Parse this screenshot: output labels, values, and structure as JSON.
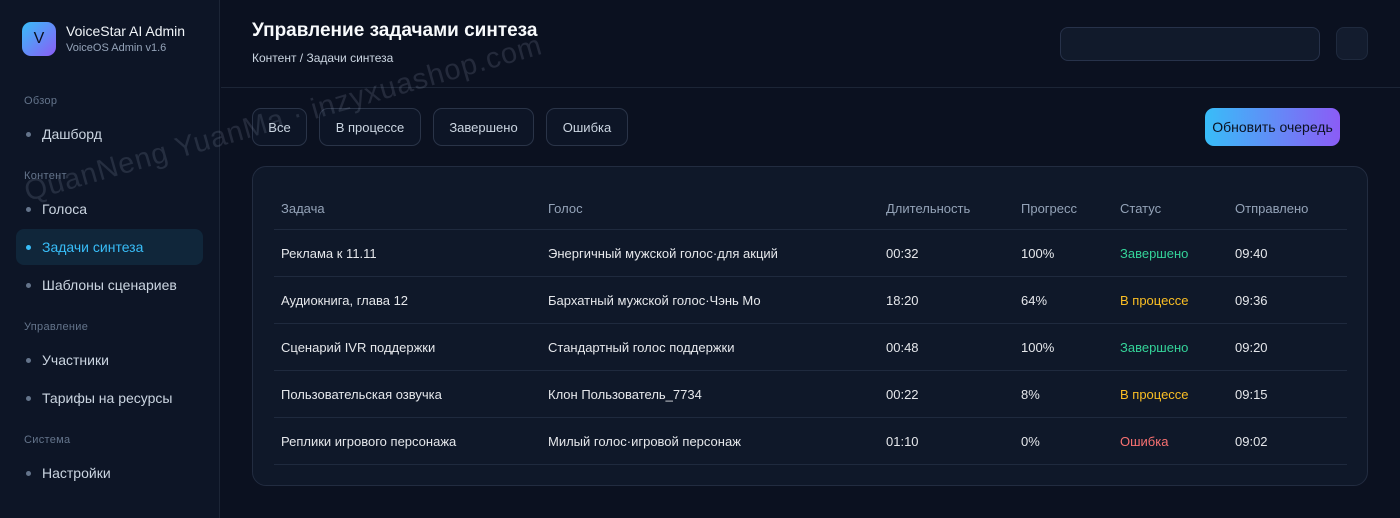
{
  "brand": {
    "logo_letter": "V",
    "title": "VoiceStar AI Admin",
    "subtitle": "VoiceOS Admin v1.6"
  },
  "sidebar": {
    "sections": [
      {
        "label": "Обзор",
        "items": [
          {
            "label": "Дашборд",
            "active": false
          }
        ]
      },
      {
        "label": "Контент",
        "items": [
          {
            "label": "Голоса",
            "active": false
          },
          {
            "label": "Задачи синтеза",
            "active": true
          },
          {
            "label": "Шаблоны сценариев",
            "active": false
          }
        ]
      },
      {
        "label": "Управление",
        "items": [
          {
            "label": "Участники",
            "active": false
          },
          {
            "label": "Тарифы на ресурсы",
            "active": false
          }
        ]
      },
      {
        "label": "Система",
        "items": [
          {
            "label": "Настройки",
            "active": false
          }
        ]
      }
    ]
  },
  "header": {
    "title": "Управление задачами синтеза",
    "breadcrumb": "Контент / Задачи синтеза"
  },
  "search": {
    "placeholder": ""
  },
  "filters": [
    "Все",
    "В процессе",
    "Завершено",
    "Ошибка"
  ],
  "actions": {
    "refresh_label": "Обновить очередь"
  },
  "table": {
    "columns": [
      "Задача",
      "Голос",
      "Длительность",
      "Прогресс",
      "Статус",
      "Отправлено"
    ],
    "rows": [
      [
        "Реклама к 11.11",
        "Энергичный мужской голос·для акций",
        "00:32",
        "100%",
        "Завершено",
        "09:40"
      ],
      [
        "Аудиокнига, глава 12",
        "Бархатный мужской голос·Чэнь Мо",
        "18:20",
        "64%",
        "В процессе",
        "09:36"
      ],
      [
        "Сценарий IVR поддержки",
        "Стандартный голос поддержки",
        "00:48",
        "100%",
        "Завершено",
        "09:20"
      ],
      [
        "Пользовательская озвучка",
        "Клон Пользователь_7734",
        "00:22",
        "8%",
        "В процессе",
        "09:15"
      ],
      [
        "Реплики игрового персонажа",
        "Милый голос·игровой персонаж",
        "01:10",
        "0%",
        "Ошибка",
        "09:02"
      ]
    ]
  },
  "status_colors": {
    "Завершено": "#34d399",
    "В процессе": "#fbbf24",
    "Ошибка": "#f87171"
  },
  "watermark": "QuanNeng YuanMa · inzyxuashop.com"
}
